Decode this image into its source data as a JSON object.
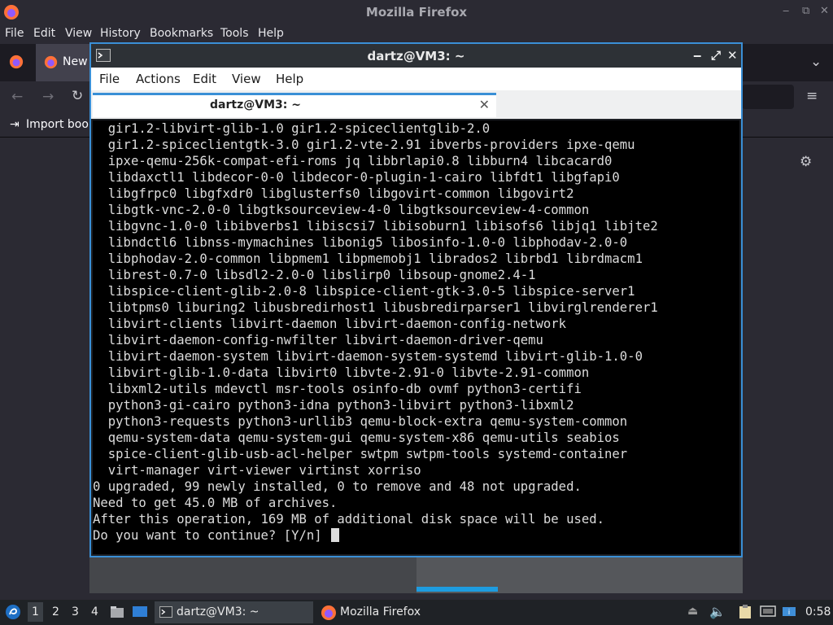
{
  "firefox": {
    "window_title": "Mozilla Firefox",
    "menu": [
      "File",
      "Edit",
      "View",
      "History",
      "Bookmarks",
      "Tools",
      "Help"
    ],
    "tab_label": "New",
    "bookmarks_import": "Import book"
  },
  "terminal": {
    "window_title": "dartz@VM3: ~",
    "menu": [
      "File",
      "Actions",
      "Edit",
      "View",
      "Help"
    ],
    "tab_label": "dartz@VM3: ~",
    "lines": [
      "  gir1.2-libvirt-glib-1.0 gir1.2-spiceclientglib-2.0",
      "  gir1.2-spiceclientgtk-3.0 gir1.2-vte-2.91 ibverbs-providers ipxe-qemu",
      "  ipxe-qemu-256k-compat-efi-roms jq libbrlapi0.8 libburn4 libcacard0",
      "  libdaxctl1 libdecor-0-0 libdecor-0-plugin-1-cairo libfdt1 libgfapi0",
      "  libgfrpc0 libgfxdr0 libglusterfs0 libgovirt-common libgovirt2",
      "  libgtk-vnc-2.0-0 libgtksourceview-4-0 libgtksourceview-4-common",
      "  libgvnc-1.0-0 libibverbs1 libiscsi7 libisoburn1 libisofs6 libjq1 libjte2",
      "  libndctl6 libnss-mymachines libonig5 libosinfo-1.0-0 libphodav-2.0-0",
      "  libphodav-2.0-common libpmem1 libpmemobj1 librados2 librbd1 librdmacm1",
      "  librest-0.7-0 libsdl2-2.0-0 libslirp0 libsoup-gnome2.4-1",
      "  libspice-client-glib-2.0-8 libspice-client-gtk-3.0-5 libspice-server1",
      "  libtpms0 liburing2 libusbredirhost1 libusbredirparser1 libvirglrenderer1",
      "  libvirt-clients libvirt-daemon libvirt-daemon-config-network",
      "  libvirt-daemon-config-nwfilter libvirt-daemon-driver-qemu",
      "  libvirt-daemon-system libvirt-daemon-system-systemd libvirt-glib-1.0-0",
      "  libvirt-glib-1.0-data libvirt0 libvte-2.91-0 libvte-2.91-common",
      "  libxml2-utils mdevctl msr-tools osinfo-db ovmf python3-certifi",
      "  python3-gi-cairo python3-idna python3-libvirt python3-libxml2",
      "  python3-requests python3-urllib3 qemu-block-extra qemu-system-common",
      "  qemu-system-data qemu-system-gui qemu-system-x86 qemu-utils seabios",
      "  spice-client-glib-usb-acl-helper swtpm swtpm-tools systemd-container",
      "  virt-manager virt-viewer virtinst xorriso",
      "0 upgraded, 99 newly installed, 0 to remove and 48 not upgraded.",
      "Need to get 45.0 MB of archives.",
      "After this operation, 169 MB of additional disk space will be used."
    ],
    "prompt": "Do you want to continue? [Y/n] "
  },
  "taskbar": {
    "workspaces": [
      "1",
      "2",
      "3",
      "4"
    ],
    "active_workspace": "1",
    "tasks": [
      {
        "label": "dartz@VM3: ~",
        "icon": "terminal-icon"
      },
      {
        "label": "Mozilla Firefox",
        "icon": "firefox-icon"
      }
    ],
    "clock": "0:58"
  },
  "colors": {
    "accent": "#3a8fd6",
    "terminal_bg": "#000000",
    "terminal_fg": "#dcdcdc",
    "taskbar_bg": "#1f2226"
  }
}
